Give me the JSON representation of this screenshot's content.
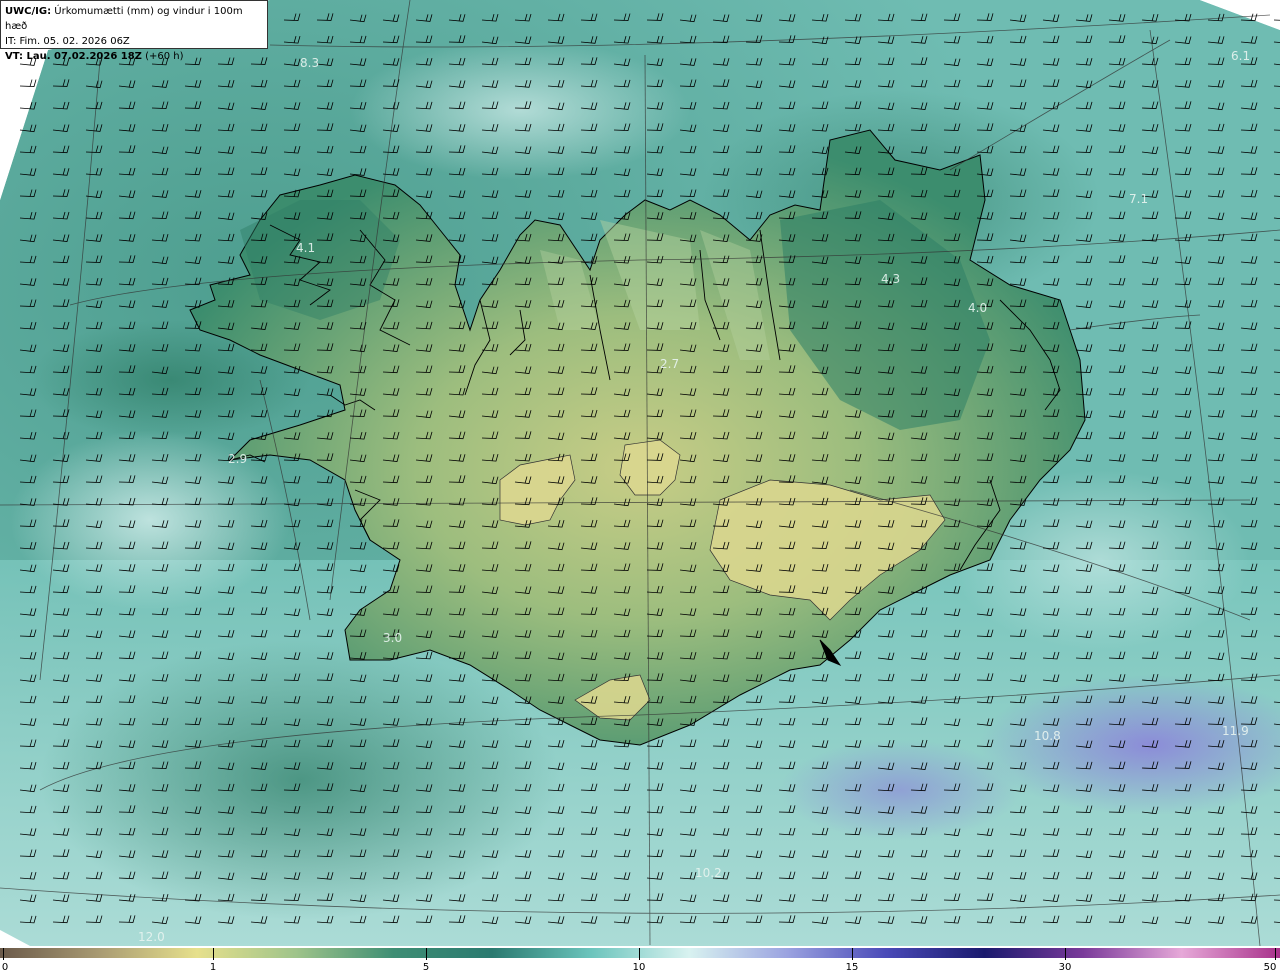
{
  "header": {
    "product": "UWC/IG:",
    "title": "Úrkomumætti (mm) og vindur i 100m hæð",
    "init_time": "IT: Fim. 05. 02. 2026 06Z",
    "valid_prefix": "VT: Lau. 07.02.2026 18Z",
    "valid_suffix": " (+60 h)"
  },
  "colors": {
    "ocean": "#5fb3a8",
    "ocean_light": "#8fd4cc",
    "ocean_pale": "#b8e6e3",
    "land_low": "#2f8a6c",
    "land_mid": "#7bb07a",
    "land_high": "#c7cc85",
    "coast": "#000000",
    "high_precip": "#8a86d4"
  },
  "map_labels": [
    {
      "text": "8.3",
      "pos": "northwest ocean"
    },
    {
      "text": "4.1",
      "pos": "westfjords"
    },
    {
      "text": "4.3",
      "pos": "northeast"
    },
    {
      "text": "4.0",
      "pos": "east"
    },
    {
      "text": "7.1",
      "pos": "northeast ocean"
    },
    {
      "text": "2.7",
      "pos": "north central"
    },
    {
      "text": "2.9",
      "pos": "snaefellsnes"
    },
    {
      "text": "3.0",
      "pos": "southwest"
    },
    {
      "text": "11.9",
      "pos": "southeast ocean"
    },
    {
      "text": "10.8",
      "pos": "south ocean"
    },
    {
      "text": "10.2",
      "pos": "south ocean low"
    },
    {
      "text": "12.0",
      "pos": "southwest corner"
    },
    {
      "text": "6.1",
      "pos": "northeast corner"
    }
  ],
  "colorbar": {
    "ticks": [
      {
        "label": "0",
        "value": 0
      },
      {
        "label": "1",
        "value": 1
      },
      {
        "label": "5",
        "value": 5
      },
      {
        "label": "10",
        "value": 10
      },
      {
        "label": "15",
        "value": 15
      },
      {
        "label": "30",
        "value": 30
      },
      {
        "label": "50",
        "value": 50
      }
    ],
    "stops": [
      "#6b5a4a",
      "#a89a72",
      "#e6e08c",
      "#9fc48a",
      "#3e8e74",
      "#2a7a70",
      "#6bc4bc",
      "#d8f2f0",
      "#9aa2e0",
      "#4a4ab8",
      "#1a1a6e",
      "#7a3a9a",
      "#e6a8d8",
      "#a8308a"
    ]
  }
}
